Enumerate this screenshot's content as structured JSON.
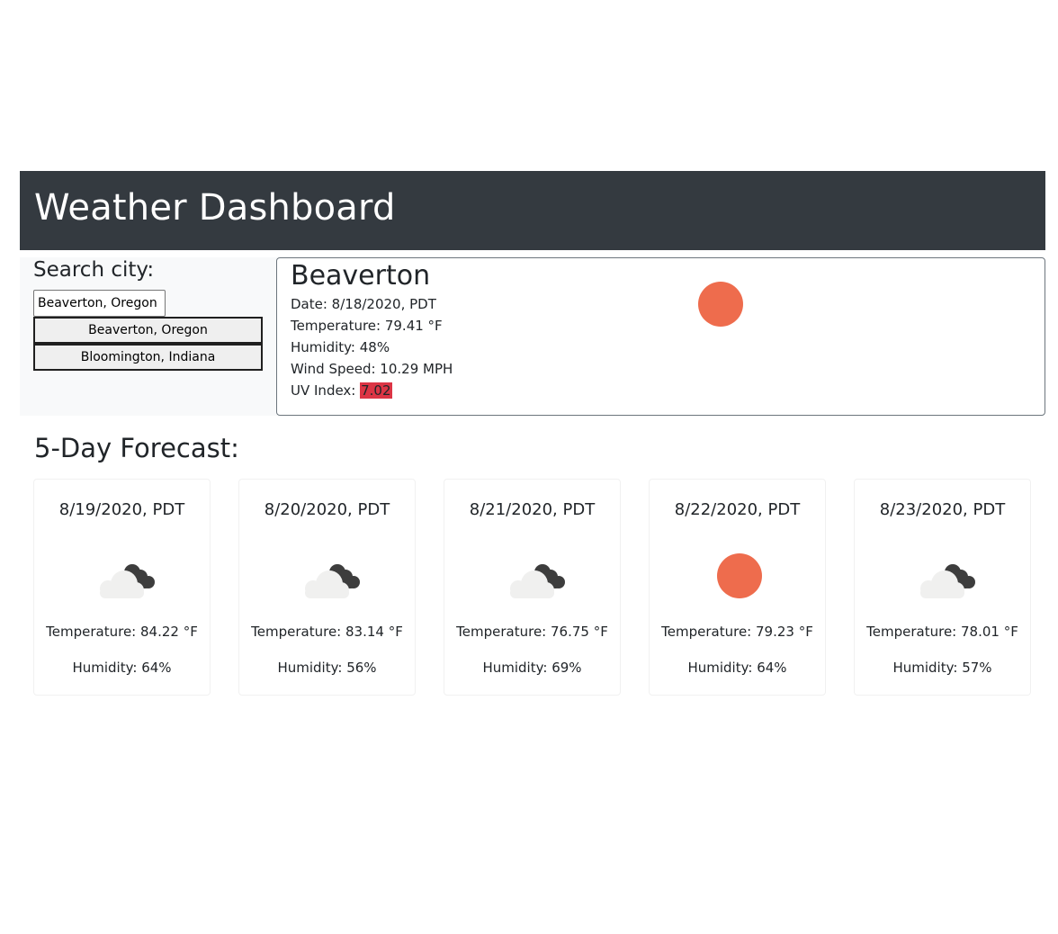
{
  "header": {
    "title": "Weather Dashboard"
  },
  "search": {
    "label": "Search city:",
    "input_value": "Beaverton, Oregon",
    "history": [
      "Beaverton, Oregon",
      "Bloomington, Indiana"
    ]
  },
  "current": {
    "city": "Beaverton",
    "date": "Date: 8/18/2020, PDT",
    "temperature": "Temperature: 79.41 °F",
    "humidity": "Humidity: 48%",
    "wind": "Wind Speed: 10.29 MPH",
    "uv_label": "UV Index: ",
    "uv_value": "7.02",
    "icon": "sun-icon"
  },
  "forecast": {
    "title": "5-Day Forecast:",
    "days": [
      {
        "date": "8/19/2020, PDT",
        "icon": "cloud-icon",
        "temp": "Temperature: 84.22 °F",
        "humidity": "Humidity: 64%"
      },
      {
        "date": "8/20/2020, PDT",
        "icon": "cloud-icon",
        "temp": "Temperature: 83.14 °F",
        "humidity": "Humidity: 56%"
      },
      {
        "date": "8/21/2020, PDT",
        "icon": "cloud-icon",
        "temp": "Temperature: 76.75 °F",
        "humidity": "Humidity: 69%"
      },
      {
        "date": "8/22/2020, PDT",
        "icon": "sun-icon",
        "temp": "Temperature: 79.23 °F",
        "humidity": "Humidity: 64%"
      },
      {
        "date": "8/23/2020, PDT",
        "icon": "cloud-icon",
        "temp": "Temperature: 78.01 °F",
        "humidity": "Humidity: 57%"
      }
    ]
  },
  "colors": {
    "header_bg": "#343a40",
    "sun": "#ee6c4d",
    "uv_high": "#dc3545"
  }
}
